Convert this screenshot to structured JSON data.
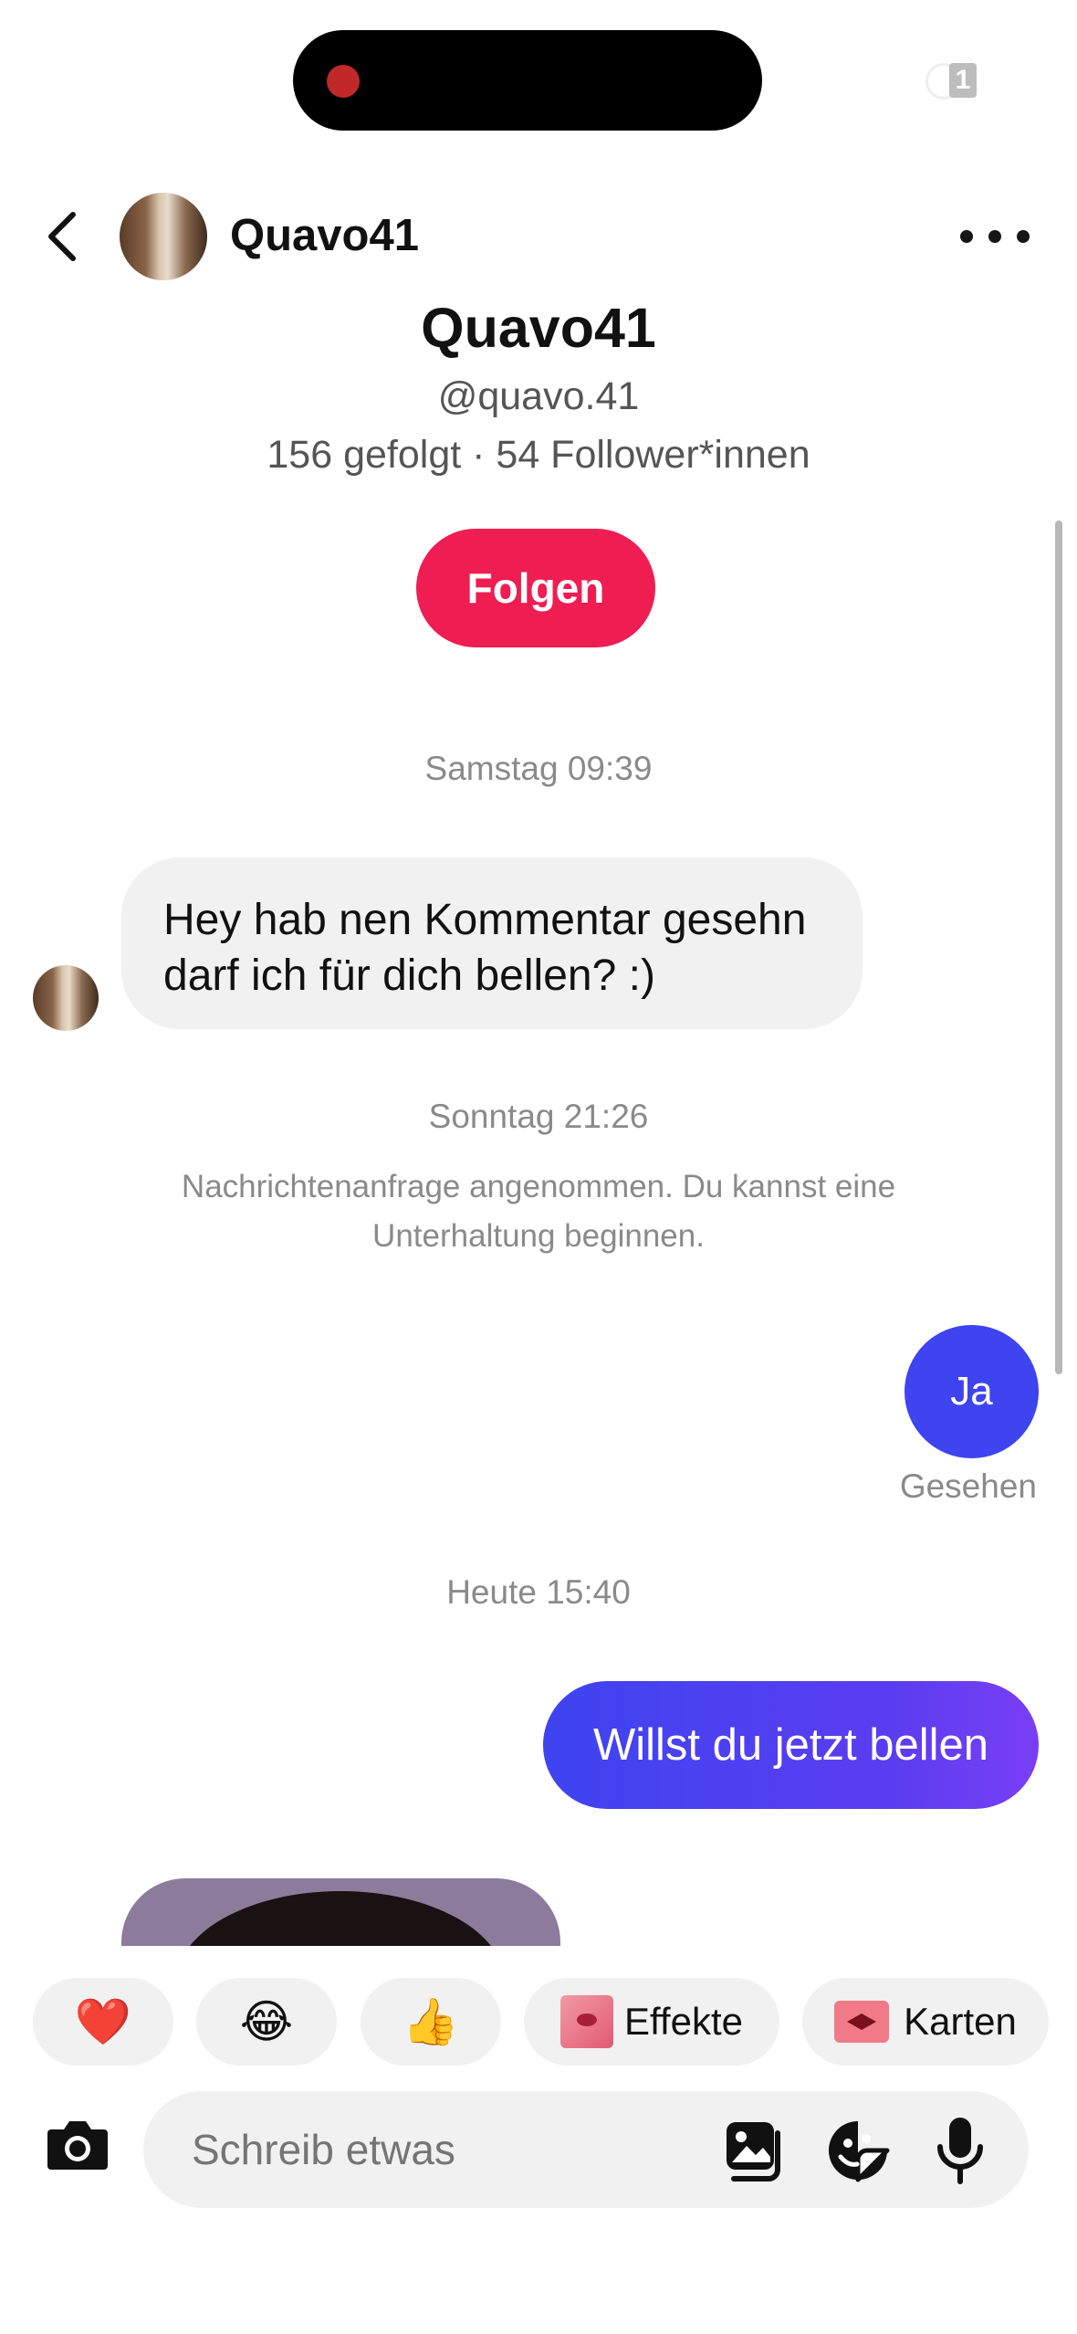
{
  "status_bar": {
    "sim_badge": "1"
  },
  "header": {
    "back_icon": "chevron-left-icon",
    "username": "Quavo41",
    "more_icon": "more-horizontal-icon"
  },
  "profile": {
    "display_name": "Quavo41",
    "handle": "@quavo.41",
    "stats": "156 gefolgt · 54 Follower*innen",
    "follow_label": "Folgen",
    "follow_color": "#ee1d52"
  },
  "conversation": {
    "ts1": "Samstag 09:39",
    "incoming_line1": "Hey hab nen Kommentar gesehn",
    "incoming_line2": "darf ich für dich bellen? :)",
    "ts2": "Sonntag 21:26",
    "system_line1": "Nachrichtenanfrage angenommen. Du kannst eine",
    "system_line2": "Unterhaltung beginnen.",
    "outgoing_1": "Ja",
    "seen_label": "Gesehen",
    "ts3": "Heute 15:40",
    "outgoing_2": "Willst du jetzt bellen",
    "outgoing_color": "#3e44ef"
  },
  "quick_replies": {
    "heart": "❤️",
    "laugh": "😂",
    "thumbs": "👍",
    "effects_label": "Effekte",
    "cards_label": "Karten"
  },
  "composer": {
    "placeholder": "Schreib etwas",
    "camera_icon": "camera-icon",
    "gallery_icon": "gallery-icon",
    "sticker_icon": "sticker-icon",
    "mic_icon": "microphone-icon"
  }
}
